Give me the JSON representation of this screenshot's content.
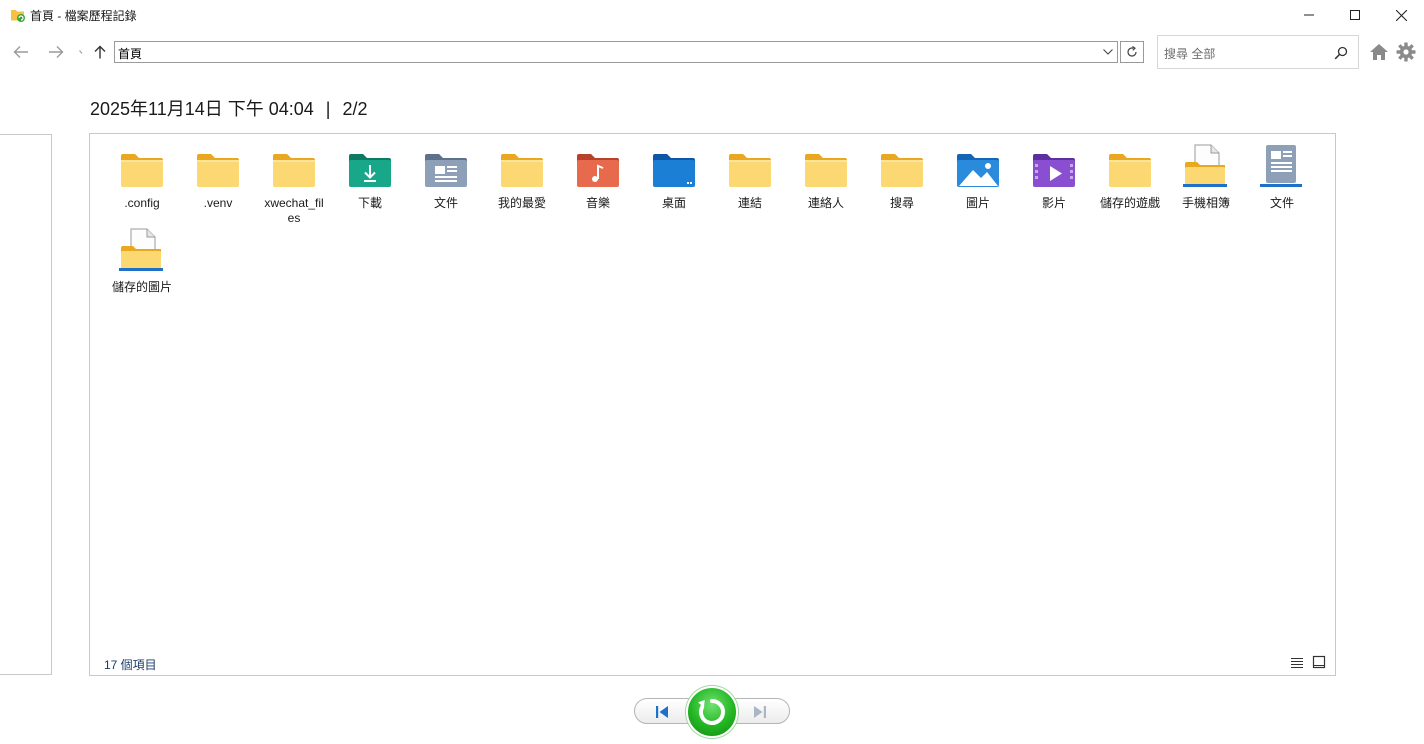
{
  "window": {
    "title": "首頁 - 檔案歷程記錄"
  },
  "navigation": {
    "address": "首頁",
    "search_placeholder": "搜尋 全部"
  },
  "snapshot": {
    "datetime": "2025年11月14日 下午 04:04",
    "separator": "|",
    "position": "2/2"
  },
  "items": [
    {
      "label": ".config",
      "icon": "folder-icon"
    },
    {
      "label": ".venv",
      "icon": "folder-icon"
    },
    {
      "label": "xwechat_files",
      "icon": "folder-icon"
    },
    {
      "label": "下載",
      "icon": "downloads-folder-icon"
    },
    {
      "label": "文件",
      "icon": "documents-folder-icon"
    },
    {
      "label": "我的最愛",
      "icon": "folder-icon"
    },
    {
      "label": "音樂",
      "icon": "music-folder-icon"
    },
    {
      "label": "桌面",
      "icon": "desktop-folder-icon"
    },
    {
      "label": "連結",
      "icon": "folder-icon"
    },
    {
      "label": "連絡人",
      "icon": "folder-icon"
    },
    {
      "label": "搜尋",
      "icon": "folder-icon"
    },
    {
      "label": "圖片",
      "icon": "pictures-folder-icon"
    },
    {
      "label": "影片",
      "icon": "videos-folder-icon"
    },
    {
      "label": "儲存的遊戲",
      "icon": "folder-icon"
    },
    {
      "label": "手機相簿",
      "icon": "library-folder-icon"
    },
    {
      "label": "文件",
      "icon": "documents-library-icon"
    },
    {
      "label": "儲存的圖片",
      "icon": "library-folder-icon"
    }
  ],
  "status": {
    "item_count": "17 個項目"
  },
  "colors": {
    "folder_yellow": "#f8c648",
    "accent_blue": "#1e70c8",
    "restore_green": "#22b522"
  }
}
